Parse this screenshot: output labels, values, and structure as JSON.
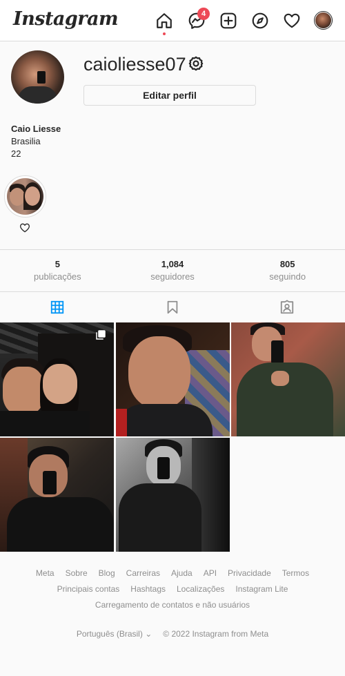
{
  "nav": {
    "logo": "Instagram",
    "messages_badge": "4"
  },
  "profile": {
    "username": "caioliesse07",
    "edit_button": "Editar perfil",
    "full_name": "Caio Liesse",
    "bio_line1": "Brasilia",
    "bio_line2": "22"
  },
  "stats": [
    {
      "value": "5",
      "label": "publicações"
    },
    {
      "value": "1,084",
      "label": "seguidores"
    },
    {
      "value": "805",
      "label": "seguindo"
    }
  ],
  "tabs": [
    "posts-grid",
    "saved",
    "tagged"
  ],
  "footer": {
    "row1": [
      "Meta",
      "Sobre",
      "Blog",
      "Carreiras",
      "Ajuda",
      "API",
      "Privacidade",
      "Termos"
    ],
    "row2": [
      "Principais contas",
      "Hashtags",
      "Localizações",
      "Instagram Lite"
    ],
    "row3": [
      "Carregamento de contatos e não usuários"
    ],
    "language": "Português (Brasil)",
    "copyright": "© 2022 Instagram from Meta"
  },
  "colors": {
    "badge": "#ed4956",
    "tab_active": "#0095f6",
    "muted": "#8e8e8e"
  }
}
